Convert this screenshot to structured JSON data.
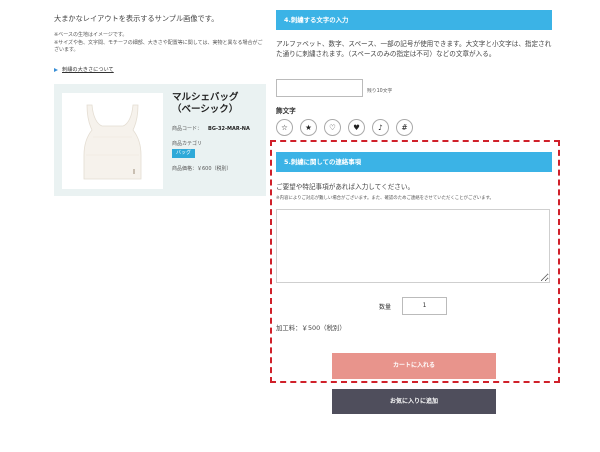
{
  "intro": {
    "lead": "大まかなレイアウトを表示するサンプル画像です。",
    "note_line1": "※ベースの生地はイメージです。",
    "note_line2": "※サイズや色、文字間、モチーフの細部、大きさや配置等に関しては、実物と異なる場合がございます。",
    "link": "刺繍の大きさについて"
  },
  "product": {
    "name_line1": "マルシェバッグ",
    "name_line2": "（ベーシック）",
    "code_label": "商品コード：",
    "code_value": "BG-32-MAR-NA",
    "category_label": "商品カテゴリ",
    "category_tag": "バッグ",
    "price": "商品価格：￥600（税別）"
  },
  "section4": {
    "title": "4.刺繍する文字の入力",
    "description": "アルファベット、数字、スペース、一部の記号が使用できます。大文字と小文字は、指定された通りに刺繍されます。（スペースのみの指定は不可）などの文章が入る。",
    "input_value": "",
    "remaining": "残り10文字",
    "decoration_label": "飾文字",
    "decorations": [
      "☆",
      "★",
      "♡",
      "♥",
      "♪",
      "#"
    ]
  },
  "section5": {
    "title": "5.刺繍に関しての連絡事項",
    "description": "ご要望や特記事項があれば入力してください。",
    "note": "※内容によりご対応が難しい場合がございます。また、確認のためご連絡をさせていただくことがございます。",
    "textarea_value": ""
  },
  "order": {
    "quantity_label": "数量",
    "quantity_value": "1",
    "fee": "加工料：￥500（税別）",
    "cart_button": "カートに入れる",
    "favorite_button": "お気に入りに追加"
  },
  "colors": {
    "section_header": "#3bb3e6",
    "category_tag": "#2fa9d8",
    "cart_button": "#e8948c",
    "favorite_button": "#4f4e5c",
    "highlight_border": "#d0202a",
    "card_background": "#eaf2f2"
  },
  "icons": {
    "link_marker": "triangle-right-icon",
    "product_image": "tote-bag-image"
  }
}
